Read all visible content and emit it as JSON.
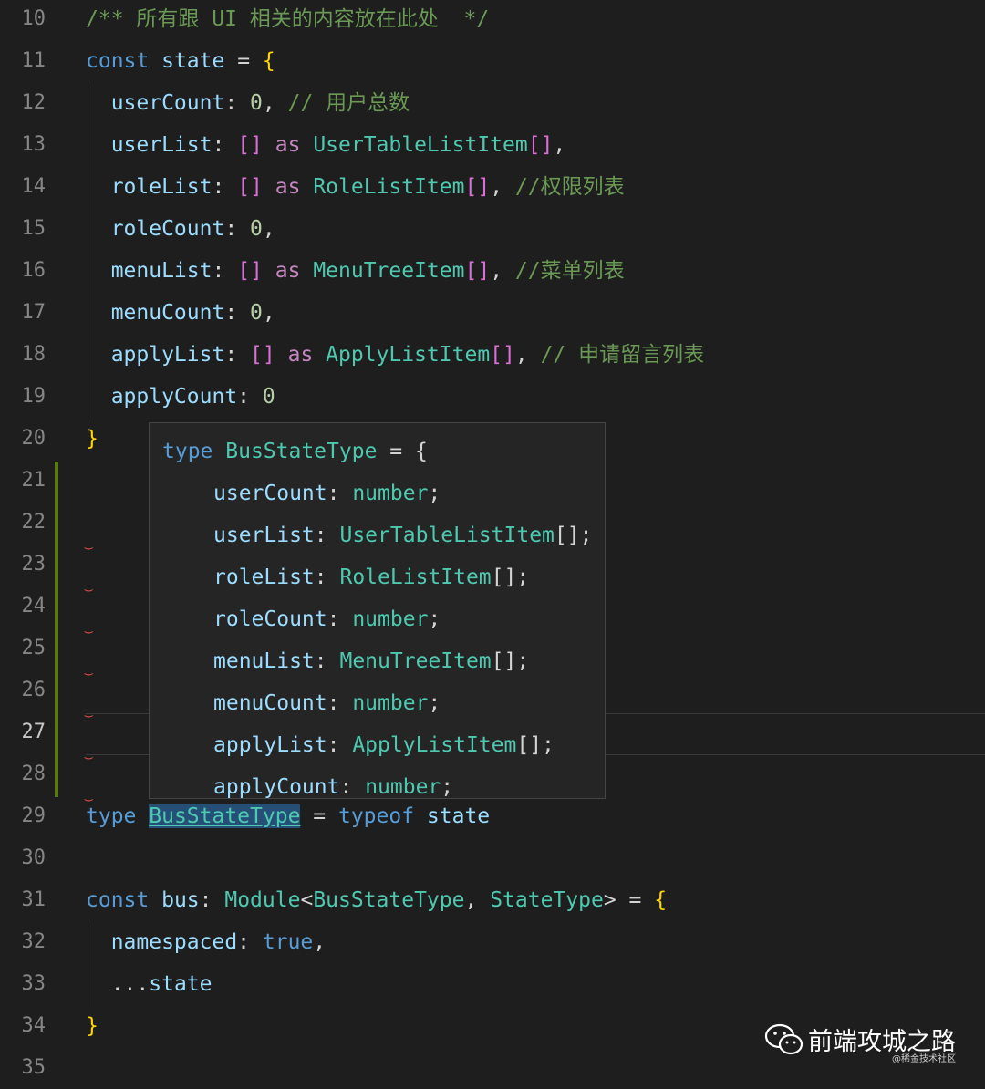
{
  "editor": {
    "lines": [
      {
        "n": "10",
        "tokens": [
          [
            "/** 所有跟 UI 相关的内容放在此处  */",
            "c-cmt"
          ]
        ]
      },
      {
        "n": "11",
        "tokens": [
          [
            "const",
            "c-kw"
          ],
          [
            " ",
            "c-op"
          ],
          [
            "state",
            "c-var"
          ],
          [
            " = ",
            "c-op"
          ],
          [
            "{",
            "c-brace"
          ]
        ]
      },
      {
        "n": "12",
        "tokens": [
          [
            "  userCount",
            "c-var"
          ],
          [
            ": ",
            "c-op"
          ],
          [
            "0",
            "c-num"
          ],
          [
            ", ",
            "c-op"
          ],
          [
            "// 用户总数",
            "c-cmt"
          ]
        ]
      },
      {
        "n": "13",
        "tokens": [
          [
            "  userList",
            "c-var"
          ],
          [
            ": ",
            "c-op"
          ],
          [
            "[]",
            "c-bracket"
          ],
          [
            " ",
            "c-op"
          ],
          [
            "as",
            "c-ctrl"
          ],
          [
            " ",
            "c-op"
          ],
          [
            "UserTableListItem",
            "c-type"
          ],
          [
            "[]",
            "c-bracket"
          ],
          [
            ",",
            "c-op"
          ]
        ]
      },
      {
        "n": "14",
        "tokens": [
          [
            "  roleList",
            "c-var"
          ],
          [
            ": ",
            "c-op"
          ],
          [
            "[]",
            "c-bracket"
          ],
          [
            " ",
            "c-op"
          ],
          [
            "as",
            "c-ctrl"
          ],
          [
            " ",
            "c-op"
          ],
          [
            "RoleListItem",
            "c-type"
          ],
          [
            "[]",
            "c-bracket"
          ],
          [
            ", ",
            "c-op"
          ],
          [
            "//权限列表",
            "c-cmt"
          ]
        ]
      },
      {
        "n": "15",
        "tokens": [
          [
            "  roleCount",
            "c-var"
          ],
          [
            ": ",
            "c-op"
          ],
          [
            "0",
            "c-num"
          ],
          [
            ",",
            "c-op"
          ]
        ]
      },
      {
        "n": "16",
        "tokens": [
          [
            "  menuList",
            "c-var"
          ],
          [
            ": ",
            "c-op"
          ],
          [
            "[]",
            "c-bracket"
          ],
          [
            " ",
            "c-op"
          ],
          [
            "as",
            "c-ctrl"
          ],
          [
            " ",
            "c-op"
          ],
          [
            "MenuTreeItem",
            "c-type"
          ],
          [
            "[]",
            "c-bracket"
          ],
          [
            ", ",
            "c-op"
          ],
          [
            "//菜单列表",
            "c-cmt"
          ]
        ]
      },
      {
        "n": "17",
        "tokens": [
          [
            "  menuCount",
            "c-var"
          ],
          [
            ": ",
            "c-op"
          ],
          [
            "0",
            "c-num"
          ],
          [
            ",",
            "c-op"
          ]
        ]
      },
      {
        "n": "18",
        "tokens": [
          [
            "  applyList",
            "c-var"
          ],
          [
            ": ",
            "c-op"
          ],
          [
            "[]",
            "c-bracket"
          ],
          [
            " ",
            "c-op"
          ],
          [
            "as",
            "c-ctrl"
          ],
          [
            " ",
            "c-op"
          ],
          [
            "ApplyListItem",
            "c-type"
          ],
          [
            "[]",
            "c-bracket"
          ],
          [
            ", ",
            "c-op"
          ],
          [
            "// 申请留言列表",
            "c-cmt"
          ]
        ]
      },
      {
        "n": "19",
        "tokens": [
          [
            "  applyCount",
            "c-var"
          ],
          [
            ": ",
            "c-op"
          ],
          [
            "0",
            "c-num"
          ]
        ]
      },
      {
        "n": "20",
        "tokens": [
          [
            "}",
            "c-brace"
          ]
        ]
      },
      {
        "n": "21",
        "tokens": []
      },
      {
        "n": "22",
        "tokens": []
      },
      {
        "n": "23",
        "tokens": []
      },
      {
        "n": "24",
        "tokens": []
      },
      {
        "n": "25",
        "tokens": []
      },
      {
        "n": "26",
        "tokens": []
      },
      {
        "n": "27",
        "tokens": [],
        "active": true
      },
      {
        "n": "28",
        "tokens": []
      },
      {
        "n": "29",
        "tokens": [
          [
            "type",
            "c-kw"
          ],
          [
            " ",
            "c-op"
          ],
          [
            "BusStateType",
            "hover-ref"
          ],
          [
            " = ",
            "c-op"
          ],
          [
            "typeof",
            "c-kw"
          ],
          [
            " ",
            "c-op"
          ],
          [
            "state",
            "c-var"
          ]
        ]
      },
      {
        "n": "30",
        "tokens": []
      },
      {
        "n": "31",
        "tokens": [
          [
            "const",
            "c-kw"
          ],
          [
            " ",
            "c-op"
          ],
          [
            "bus",
            "c-var"
          ],
          [
            ": ",
            "c-op"
          ],
          [
            "Module",
            "c-type"
          ],
          [
            "<",
            "c-op"
          ],
          [
            "BusStateType",
            "c-type"
          ],
          [
            ", ",
            "c-op"
          ],
          [
            "StateType",
            "c-type"
          ],
          [
            "> = ",
            "c-op"
          ],
          [
            "{",
            "c-brace"
          ]
        ]
      },
      {
        "n": "32",
        "tokens": [
          [
            "  namespaced",
            "c-var"
          ],
          [
            ": ",
            "c-op"
          ],
          [
            "true",
            "c-kw"
          ],
          [
            ",",
            "c-op"
          ]
        ]
      },
      {
        "n": "33",
        "tokens": [
          [
            "  ...",
            "c-op"
          ],
          [
            "state",
            "c-var"
          ]
        ]
      },
      {
        "n": "34",
        "tokens": [
          [
            "}",
            "c-brace"
          ]
        ]
      },
      {
        "n": "35",
        "tokens": []
      }
    ]
  },
  "hover": {
    "lines": [
      {
        "indent": false,
        "tokens": [
          [
            "type",
            "c-kw"
          ],
          [
            " ",
            "c-op"
          ],
          [
            "BusStateType",
            "c-type"
          ],
          [
            " = {",
            "c-op"
          ]
        ]
      },
      {
        "indent": true,
        "tokens": [
          [
            "userCount",
            "c-var"
          ],
          [
            ": ",
            "c-op"
          ],
          [
            "number",
            "c-type"
          ],
          [
            ";",
            "c-op"
          ]
        ]
      },
      {
        "indent": true,
        "tokens": [
          [
            "userList",
            "c-var"
          ],
          [
            ": ",
            "c-op"
          ],
          [
            "UserTableListItem",
            "c-type"
          ],
          [
            "[];",
            "c-op"
          ]
        ]
      },
      {
        "indent": true,
        "tokens": [
          [
            "roleList",
            "c-var"
          ],
          [
            ": ",
            "c-op"
          ],
          [
            "RoleListItem",
            "c-type"
          ],
          [
            "[];",
            "c-op"
          ]
        ]
      },
      {
        "indent": true,
        "tokens": [
          [
            "roleCount",
            "c-var"
          ],
          [
            ": ",
            "c-op"
          ],
          [
            "number",
            "c-type"
          ],
          [
            ";",
            "c-op"
          ]
        ]
      },
      {
        "indent": true,
        "tokens": [
          [
            "menuList",
            "c-var"
          ],
          [
            ": ",
            "c-op"
          ],
          [
            "MenuTreeItem",
            "c-type"
          ],
          [
            "[];",
            "c-op"
          ]
        ]
      },
      {
        "indent": true,
        "tokens": [
          [
            "menuCount",
            "c-var"
          ],
          [
            ": ",
            "c-op"
          ],
          [
            "number",
            "c-type"
          ],
          [
            ";",
            "c-op"
          ]
        ]
      },
      {
        "indent": true,
        "tokens": [
          [
            "applyList",
            "c-var"
          ],
          [
            ": ",
            "c-op"
          ],
          [
            "ApplyListItem",
            "c-type"
          ],
          [
            "[];",
            "c-op"
          ]
        ]
      },
      {
        "indent": true,
        "tokens": [
          [
            "applyCount",
            "c-var"
          ],
          [
            ": ",
            "c-op"
          ],
          [
            "number",
            "c-type"
          ],
          [
            ";",
            "c-op"
          ]
        ]
      }
    ]
  },
  "watermark": {
    "icon": "wechat-icon",
    "title": "前端攻城之路",
    "subtitle": "@稀金技术社区"
  },
  "colors": {
    "background": "#1e1e1e",
    "keyword": "#569cd6",
    "type": "#4ec9b0",
    "variable": "#9cdcfe",
    "comment": "#6a9955",
    "git_modified": "#587c0c"
  }
}
